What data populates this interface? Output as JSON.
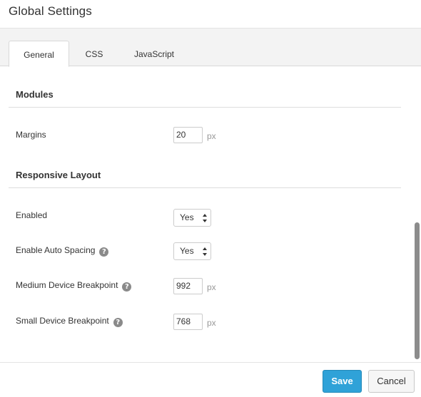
{
  "window": {
    "title": "Global Settings"
  },
  "tabs": [
    {
      "label": "General",
      "active": true
    },
    {
      "label": "CSS",
      "active": false
    },
    {
      "label": "JavaScript",
      "active": false
    }
  ],
  "sections": {
    "modules": {
      "title": "Modules",
      "margins": {
        "label": "Margins",
        "value": "20",
        "unit": "px"
      }
    },
    "responsive": {
      "title": "Responsive Layout",
      "enabled": {
        "label": "Enabled",
        "value": "Yes"
      },
      "auto_spacing": {
        "label": "Enable Auto Spacing",
        "value": "Yes"
      },
      "medium_breakpoint": {
        "label": "Medium Device Breakpoint",
        "value": "992",
        "unit": "px"
      },
      "small_breakpoint": {
        "label": "Small Device Breakpoint",
        "value": "768",
        "unit": "px"
      }
    }
  },
  "help_icon": "?",
  "footer": {
    "save_label": "Save",
    "cancel_label": "Cancel"
  },
  "colors": {
    "accent": "#2fa2d8",
    "tab_bar": "#f3f3f3",
    "scrollbar": "#8c8c8c"
  },
  "icons": [
    "help-icon",
    "select-arrows-icon"
  ]
}
